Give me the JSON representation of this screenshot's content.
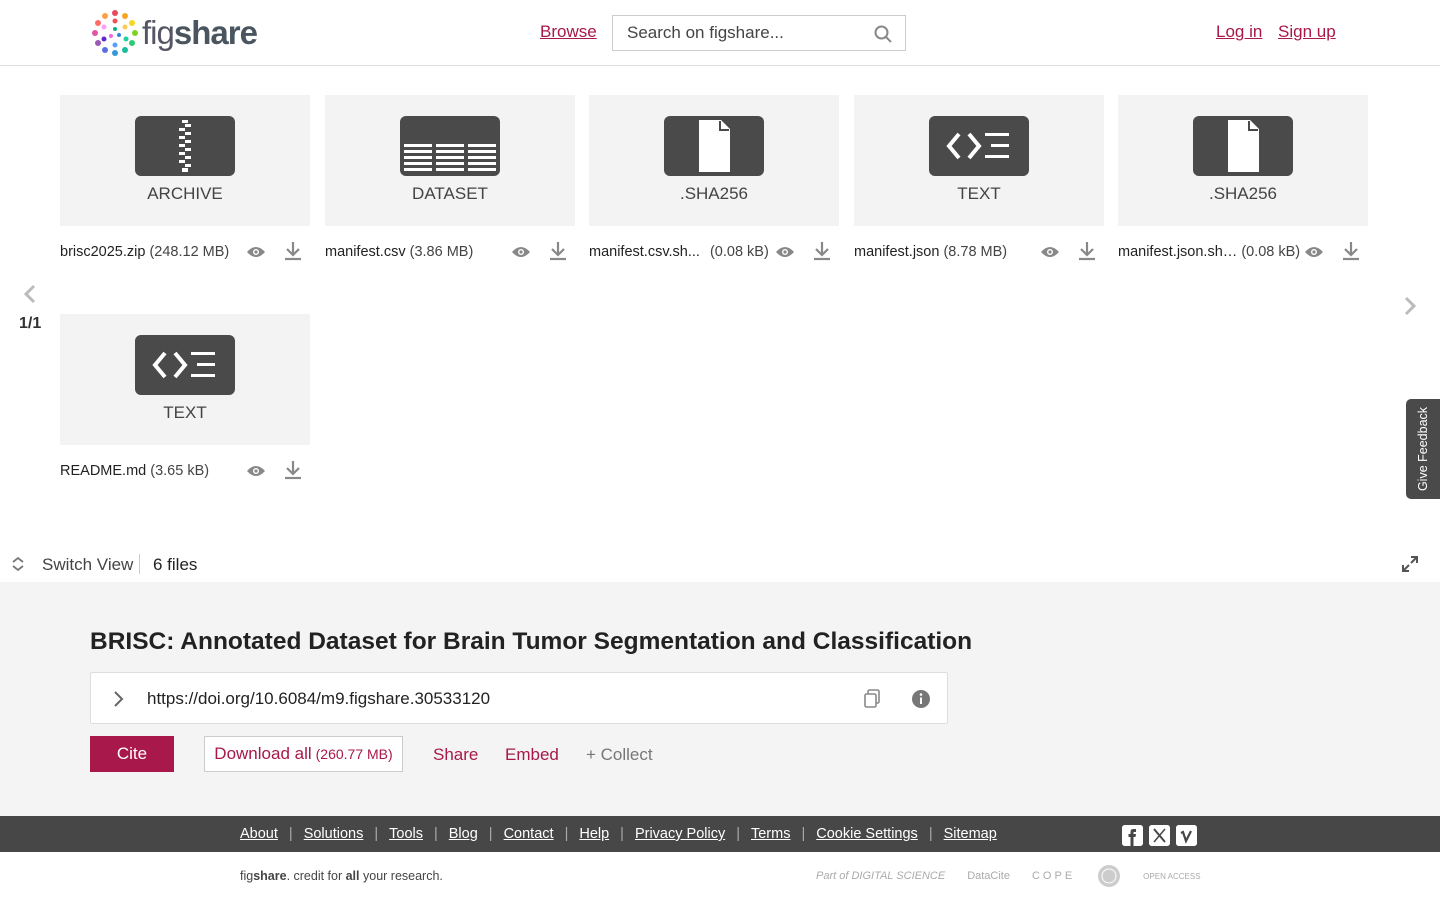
{
  "header": {
    "logo_text_a": "fig",
    "logo_text_b": "share",
    "browse": "Browse",
    "search_placeholder": "Search on figshare...",
    "login": "Log in",
    "signup": "Sign up"
  },
  "files": [
    {
      "type": "ARCHIVE",
      "name": "brisc2025.zip",
      "size": "(248.12 MB)",
      "icon": "archive-icon"
    },
    {
      "type": "DATASET",
      "name": "manifest.csv",
      "size": "(3.86 MB)",
      "icon": "table-icon"
    },
    {
      "type": ".SHA256",
      "name": "manifest.csv.sh...",
      "size": "(0.08 kB)",
      "icon": "document-icon"
    },
    {
      "type": "TEXT",
      "name": "manifest.json",
      "size": "(8.78 MB)",
      "icon": "code-icon"
    },
    {
      "type": ".SHA256",
      "name": "manifest.json.sh…",
      "size": "(0.08 kB)",
      "icon": "document-icon"
    },
    {
      "type": "TEXT",
      "name": "README.md",
      "size": "(3.65 kB)",
      "icon": "code-icon"
    }
  ],
  "pager": {
    "count": "1/1"
  },
  "feedback": "Give Feedback",
  "switchbar": {
    "switch_label": "Switch View",
    "files_count": "6 files"
  },
  "article": {
    "title": "BRISC: Annotated Dataset for Brain Tumor Segmentation and Classification",
    "doi": "https://doi.org/10.6084/m9.figshare.30533120",
    "cite": "Cite",
    "download_all": "Download all",
    "download_size": "(260.77 MB)",
    "share": "Share",
    "embed": "Embed",
    "collect": "+ Collect"
  },
  "footer": {
    "links": [
      "About",
      "Solutions",
      "Tools",
      "Blog",
      "Contact",
      "Help",
      "Privacy Policy",
      "Terms",
      "Cookie Settings",
      "Sitemap"
    ],
    "tagline_a": "fig",
    "tagline_b": "share",
    "tagline_c": ". credit for ",
    "tagline_d": "all",
    "tagline_e": " your research.",
    "partners": [
      "Part of DIGITAL SCIENCE",
      "DataCite",
      "COPE",
      "OPEN ACCESS"
    ]
  },
  "colors": {
    "accent": "#a8184a",
    "dark": "#474747",
    "tile_bg": "#f3f3f3",
    "icon_bg": "#4a4a4a"
  }
}
